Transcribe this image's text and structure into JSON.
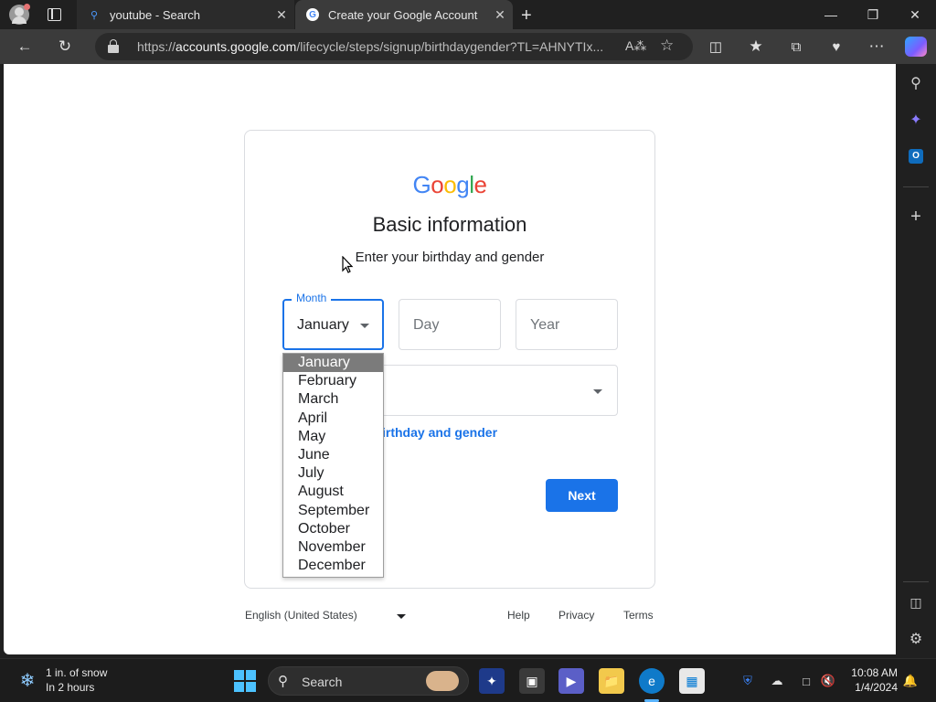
{
  "browser": {
    "tabs": [
      {
        "label": "youtube - Search",
        "icon": "search-icon"
      },
      {
        "label": "Create your Google Account",
        "icon": "google-icon"
      }
    ],
    "address": {
      "scheme": "https://",
      "host": "accounts.google.com",
      "path": "/lifecycle/steps/signup/birthdaygender?TL=AHNYTIx..."
    },
    "window_controls": [
      "minimize",
      "restore",
      "close"
    ]
  },
  "page": {
    "logo": {
      "letters": [
        "G",
        "o",
        "o",
        "g",
        "l",
        "e"
      ],
      "colors": [
        "#4285F4",
        "#EA4335",
        "#FBBC05",
        "#4285F4",
        "#34A853",
        "#EA4335"
      ]
    },
    "title": "Basic information",
    "subtitle": "Enter your birthday and gender",
    "month": {
      "label": "Month",
      "value": "January"
    },
    "day": {
      "placeholder": "Day"
    },
    "year": {
      "placeholder": "Year"
    },
    "why_link": "irthday and gender",
    "next_button": "Next",
    "month_options": [
      "January",
      "February",
      "March",
      "April",
      "May",
      "June",
      "July",
      "August",
      "September",
      "October",
      "November",
      "December"
    ],
    "selected_month_index": 0,
    "accent": "#1a73e8"
  },
  "footer": {
    "language": "English (United States)",
    "links": {
      "help": "Help",
      "privacy": "Privacy",
      "terms": "Terms"
    }
  },
  "taskbar": {
    "weather_line1": "1 in. of snow",
    "weather_line2": "In 2 hours",
    "search_label": "Search",
    "time": "10:08 AM",
    "date": "1/4/2024"
  }
}
